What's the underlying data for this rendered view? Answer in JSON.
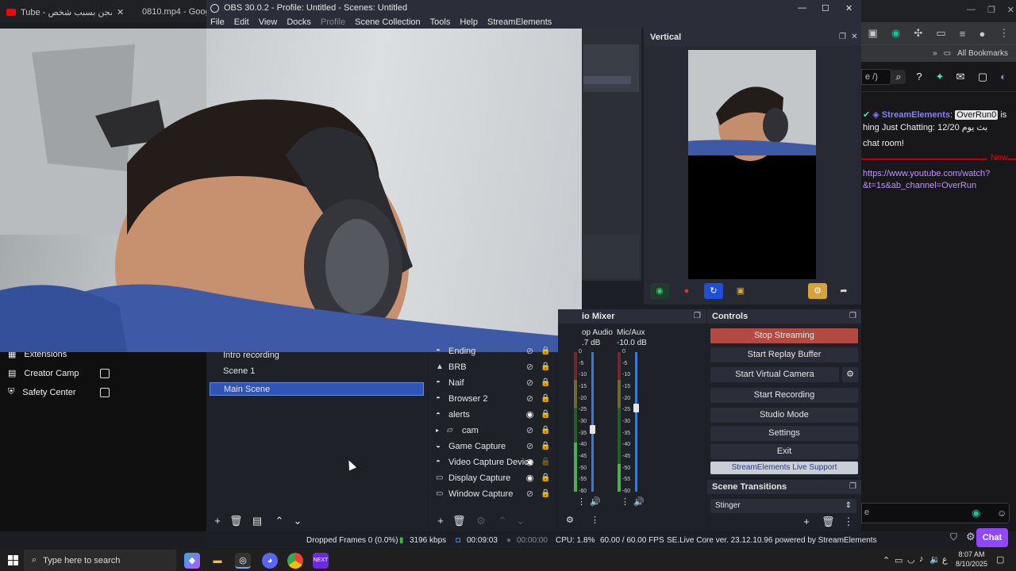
{
  "browser": {
    "tab1": "Tube - كنت يتسجن بسبب شخص",
    "tab2": "0810.mp4 - Google",
    "all_bookmarks": "All Bookmarks",
    "search_fragment": "e /)",
    "chat_user": "StreamElements",
    "chat_user_suffix": ":",
    "chat_mention": "OverRun0",
    "chat_is": "is",
    "chat_line2": "hing Just Chatting: 12/20 بث يوم",
    "chat_line3": "chat room!",
    "new_label": "New",
    "link_line1": "https://www.youtube.com/watch?",
    "link_line2": "&t=1s&ab_channel=OverRun",
    "chat_input_fragment": "e",
    "chat_button": "Chat"
  },
  "yt_sidebar": {
    "items": [
      {
        "label": "Extensions"
      },
      {
        "label": "Creator Camp"
      },
      {
        "label": "Safety Center"
      }
    ]
  },
  "obs": {
    "title": "OBS 30.0.2 - Profile: Untitled - Scenes: Untitled",
    "menu": [
      "File",
      "Edit",
      "View",
      "Docks",
      "Profile",
      "Scene Collection",
      "Tools",
      "Help",
      "StreamElements"
    ],
    "vertical_title": "Vertical",
    "scenes": [
      {
        "name": "Intro recording",
        "selected": false
      },
      {
        "name": "Scene 1",
        "selected": false
      },
      {
        "name": "Main Scene",
        "selected": true
      }
    ],
    "sources": [
      {
        "name": "Ending",
        "icon": "browser-icon",
        "visible": false,
        "locked": true
      },
      {
        "name": "BRB",
        "icon": "image-icon",
        "visible": false,
        "locked": true
      },
      {
        "name": "Naif",
        "icon": "browser-icon",
        "visible": false,
        "locked": true
      },
      {
        "name": "Browser 2",
        "icon": "browser-icon",
        "visible": false,
        "locked": true
      },
      {
        "name": "alerts",
        "icon": "browser-icon",
        "visible": true,
        "locked": true
      },
      {
        "name": "cam",
        "icon": "group-icon",
        "visible": false,
        "locked": true
      },
      {
        "name": "Game Capture",
        "icon": "gamepad-icon",
        "visible": false,
        "locked": true
      },
      {
        "name": "Video Capture Device",
        "icon": "camera-icon",
        "visible": true,
        "locked": false
      },
      {
        "name": "Display Capture",
        "icon": "monitor-icon",
        "visible": true,
        "locked": true
      },
      {
        "name": "Window Capture",
        "icon": "window-icon",
        "visible": false,
        "locked": true
      }
    ],
    "mixer": {
      "title": "io Mixer",
      "ch1_name": "op Audio",
      "ch1_db": ".7 dB",
      "ch2_name": "Mic/Aux",
      "ch2_db": "-10.0 dB",
      "ch1_level": 0.35,
      "ch2_level": 0.2,
      "ch1_volume": 0.45,
      "ch2_volume": 0.6,
      "ticks": [
        "0",
        "-5",
        "-10",
        "-15",
        "-20",
        "-25",
        "-30",
        "-35",
        "-40",
        "-45",
        "-50",
        "-55",
        "-60"
      ]
    },
    "controls": {
      "title": "Controls",
      "buttons": [
        "Stop Streaming",
        "Start Replay Buffer",
        "Start Virtual Camera",
        "Start Recording",
        "Studio Mode",
        "Settings",
        "Exit",
        "StreamElements Live Support"
      ]
    },
    "transitions": {
      "title": "Scene Transitions",
      "selected": "Stinger"
    },
    "status": {
      "dropped": "Dropped Frames 0 (0.0%)",
      "kbps": "3196 kbps",
      "stream_time": "00:09:03",
      "rec_time": "00:00:00",
      "cpu": "CPU: 1.8%",
      "fps": "60.00 / 60.00 FPS",
      "se": "SE.Live Core ver. 23.12.10.96 powered by StreamElements"
    }
  },
  "taskbar": {
    "search_placeholder": "Type here to search",
    "time": "8:07 AM",
    "date": "8/10/2025",
    "lang": "ع"
  },
  "colors": {
    "obs_bg": "#1d1f26",
    "stream_button": "#b24a43",
    "selection": "#2f55b8",
    "twitch_purple": "#9147ff"
  }
}
